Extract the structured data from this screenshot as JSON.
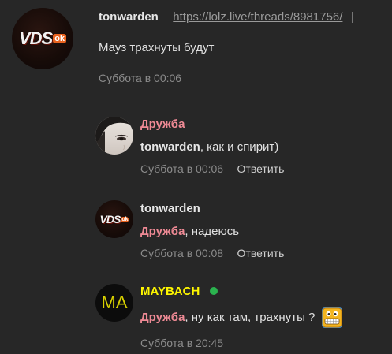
{
  "post": {
    "author": "tonwarden",
    "link": "https://lolz.live/threads/8981756/",
    "separator": "|",
    "text": "Мауз трахнуты будут",
    "time": "Суббота в 00:06",
    "avatar_text": "VDS",
    "avatar_badge": "ok"
  },
  "comments": [
    {
      "author": "Дружба",
      "mention": "tonwarden",
      "text": ", как и спирит)",
      "time": "Суббота в 00:06",
      "reply_label": "Ответить"
    },
    {
      "author": "tonwarden",
      "mention": "Дружба",
      "text": ", надеюсь",
      "time": "Суббота в 00:08",
      "reply_label": "Ответить",
      "avatar_text": "VDS",
      "avatar_badge": "ok"
    },
    {
      "author": "MAYBACH",
      "mention": "Дружба",
      "text": ", ну как там, трахнуты ?",
      "time": "Суббота в 20:45",
      "avatar_text": "MA",
      "status_color": "#2bb34f"
    }
  ],
  "colors": {
    "background": "#272727",
    "pink_name": "#ef8a95",
    "yellow_name": "#fff700",
    "meta": "#8b8b8b"
  },
  "icons": [
    "online-status-icon",
    "grin-emoji-icon"
  ]
}
